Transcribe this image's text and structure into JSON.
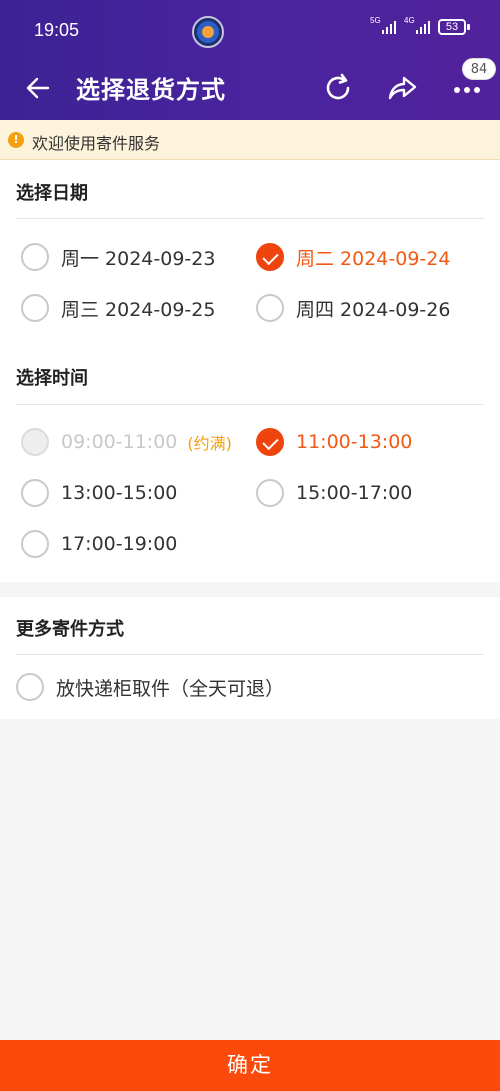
{
  "status_bar": {
    "time": "19:05",
    "signal1_label": "5G",
    "signal2_label": "4G",
    "battery": "53"
  },
  "toolbar": {
    "title": "选择退货方式",
    "badge_count": "84",
    "icons": [
      "back-arrow-icon",
      "refresh-icon",
      "share-icon",
      "more-icon"
    ]
  },
  "notice": {
    "icon": "!",
    "text": "欢迎使用寄件服务"
  },
  "date_section": {
    "title": "选择日期",
    "options": [
      {
        "label": "周一 2024-09-23",
        "checked": false
      },
      {
        "label": "周二 2024-09-24",
        "checked": true
      },
      {
        "label": "周三 2024-09-25",
        "checked": false
      },
      {
        "label": "周四 2024-09-26",
        "checked": false
      }
    ]
  },
  "time_section": {
    "title": "选择时间",
    "options": [
      {
        "label": "09:00-11:00",
        "tag": "(约满)",
        "checked": false,
        "disabled": true
      },
      {
        "label": "11:00-13:00",
        "checked": true,
        "disabled": false
      },
      {
        "label": "13:00-15:00",
        "checked": false,
        "disabled": false
      },
      {
        "label": "15:00-17:00",
        "checked": false,
        "disabled": false
      },
      {
        "label": "17:00-19:00",
        "checked": false,
        "disabled": false
      }
    ]
  },
  "more_section": {
    "title": "更多寄件方式",
    "options": [
      {
        "label": "放快递柜取件（全天可退）",
        "checked": false
      }
    ]
  },
  "confirm_label": "确定",
  "colors": {
    "header": "#4a239e",
    "accent": "#f0440e",
    "confirm_bg": "#fb4a0c",
    "notice_bg": "#fdf3da",
    "tag": "#f0a010"
  }
}
